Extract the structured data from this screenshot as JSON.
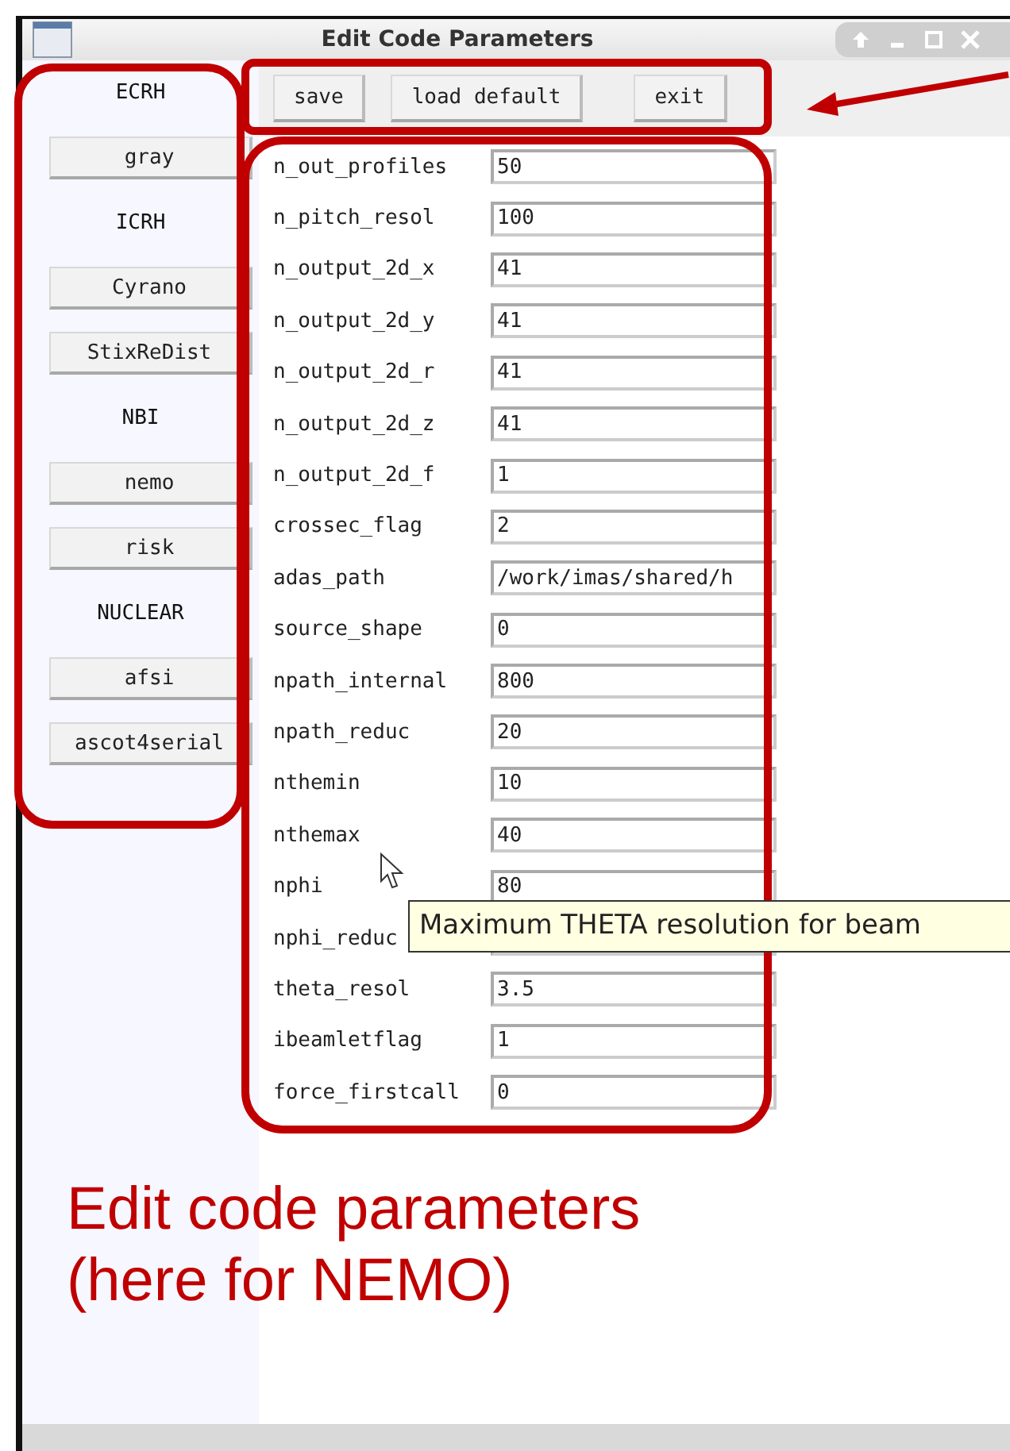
{
  "window": {
    "title": "Edit Code Parameters"
  },
  "sidebar": {
    "items": [
      {
        "kind": "header",
        "label": "ECRH"
      },
      {
        "kind": "button",
        "label": "gray"
      },
      {
        "kind": "header",
        "label": "ICRH"
      },
      {
        "kind": "button",
        "label": "Cyrano"
      },
      {
        "kind": "button",
        "label": "StixReDist"
      },
      {
        "kind": "header",
        "label": "NBI"
      },
      {
        "kind": "button",
        "label": "nemo"
      },
      {
        "kind": "button",
        "label": "risk"
      },
      {
        "kind": "header",
        "label": "NUCLEAR"
      },
      {
        "kind": "button",
        "label": "afsi"
      },
      {
        "kind": "button",
        "label": "ascot4serial"
      }
    ]
  },
  "toolbar": {
    "buttons": [
      "save",
      "load default",
      "exit"
    ]
  },
  "parameters": [
    {
      "label": "n_out_profiles",
      "value": "50"
    },
    {
      "label": "n_pitch_resol",
      "value": "100"
    },
    {
      "label": "n_output_2d_x",
      "value": "41"
    },
    {
      "label": "n_output_2d_y",
      "value": "41"
    },
    {
      "label": "n_output_2d_r",
      "value": "41"
    },
    {
      "label": "n_output_2d_z",
      "value": "41"
    },
    {
      "label": "n_output_2d_f",
      "value": "1"
    },
    {
      "label": "crossec_flag",
      "value": "2"
    },
    {
      "label": "adas_path",
      "value": "/work/imas/shared/h"
    },
    {
      "label": "source_shape",
      "value": "0"
    },
    {
      "label": "npath_internal",
      "value": "800"
    },
    {
      "label": "npath_reduc",
      "value": "20"
    },
    {
      "label": "nthemin",
      "value": "10"
    },
    {
      "label": "nthemax",
      "value": "40"
    },
    {
      "label": "nphi",
      "value": "80"
    },
    {
      "label": "nphi_reduc"
    },
    {
      "label": "theta_resol",
      "value": "3.5"
    },
    {
      "label": "ibeamletflag",
      "value": "1"
    },
    {
      "label": "force_firstcall",
      "value": "0"
    }
  ],
  "tooltip": {
    "text": "Maximum THETA resolution for beam"
  },
  "caption": {
    "lines": [
      "Edit code parameters",
      "(here for NEMO)"
    ]
  }
}
